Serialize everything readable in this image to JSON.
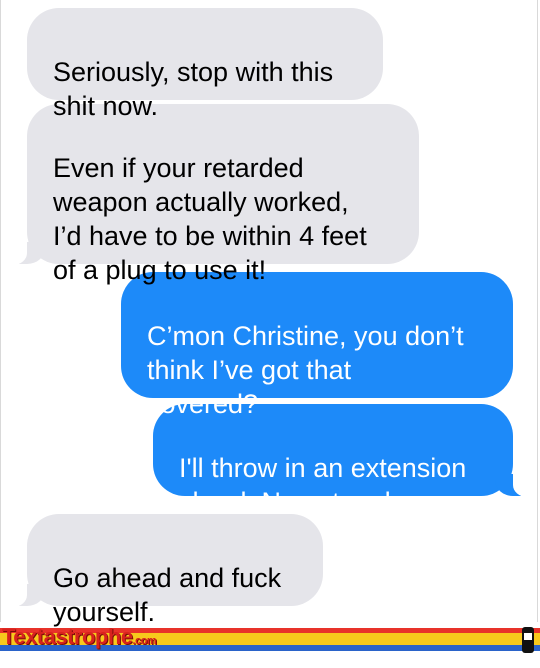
{
  "messages": [
    {
      "direction": "received",
      "text": "Seriously, stop with this\nshit now."
    },
    {
      "direction": "received",
      "text": "Even if your retarded\nweapon actually worked,\nI’d have to be within 4 feet\nof a plug to use it!"
    },
    {
      "direction": "sent",
      "text": "C’mon Christine, you don’t\nthink I’ve got that\ncovered?"
    },
    {
      "direction": "sent",
      "text": "I'll throw in an extension\nchord. No extra charge."
    },
    {
      "direction": "received",
      "text": "Go ahead and fuck\nyourself."
    }
  ],
  "branding": {
    "logo_main": "Textastrophe",
    "logo_suffix": ".com"
  },
  "colors": {
    "received_bubble": "#e5e5ea",
    "sent_bubble": "#1d8af9",
    "stripe_red": "#e8322a",
    "stripe_yellow": "#f7c91c",
    "stripe_blue": "#2a63c9"
  }
}
